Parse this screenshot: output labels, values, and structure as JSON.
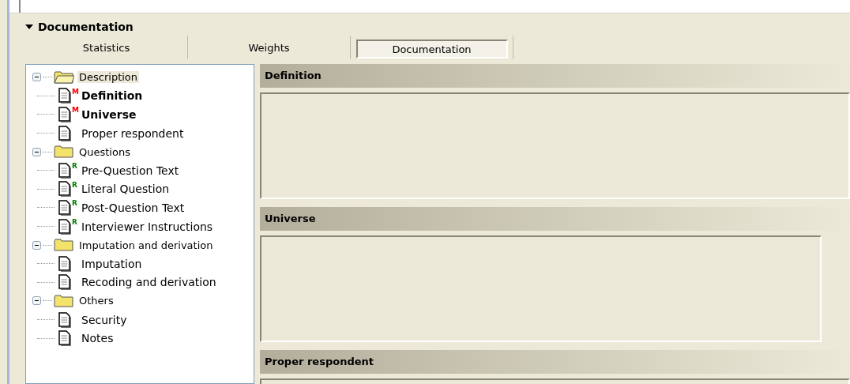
{
  "section": {
    "title": "Documentation",
    "expanded": true
  },
  "tabs": [
    {
      "label": "Statistics",
      "selected": false
    },
    {
      "label": "Weights",
      "selected": false
    },
    {
      "label": "Documentation",
      "selected": true
    }
  ],
  "tree": [
    {
      "label": "Description",
      "selected": true,
      "expanded": true,
      "children": [
        {
          "label": "Definition",
          "bold": true,
          "badge": "M",
          "color": "#ff0000"
        },
        {
          "label": "Universe",
          "bold": true,
          "badge": "M",
          "color": "#ff0000"
        },
        {
          "label": "Proper respondent",
          "bold": false
        }
      ]
    },
    {
      "label": "Questions",
      "selected": false,
      "expanded": true,
      "children": [
        {
          "label": "Pre-Question Text",
          "bold": false,
          "badge": "R",
          "color": "#008000"
        },
        {
          "label": "Literal Question",
          "bold": false,
          "badge": "R",
          "color": "#008000"
        },
        {
          "label": "Post-Question Text",
          "bold": false,
          "badge": "R",
          "color": "#008000"
        },
        {
          "label": "Interviewer Instructions",
          "bold": false,
          "badge": "R",
          "color": "#008000"
        }
      ]
    },
    {
      "label": "Imputation and derivation",
      "selected": false,
      "expanded": true,
      "children": [
        {
          "label": "Imputation",
          "bold": false
        },
        {
          "label": "Recoding and derivation",
          "bold": false
        }
      ]
    },
    {
      "label": "Others",
      "selected": false,
      "expanded": true,
      "children": [
        {
          "label": "Security",
          "bold": false
        },
        {
          "label": "Notes",
          "bold": false
        }
      ]
    }
  ],
  "fields": [
    {
      "title": "Definition",
      "narrow": false
    },
    {
      "title": "Universe",
      "narrow": true
    },
    {
      "title": "Proper respondent",
      "narrow": false
    }
  ]
}
